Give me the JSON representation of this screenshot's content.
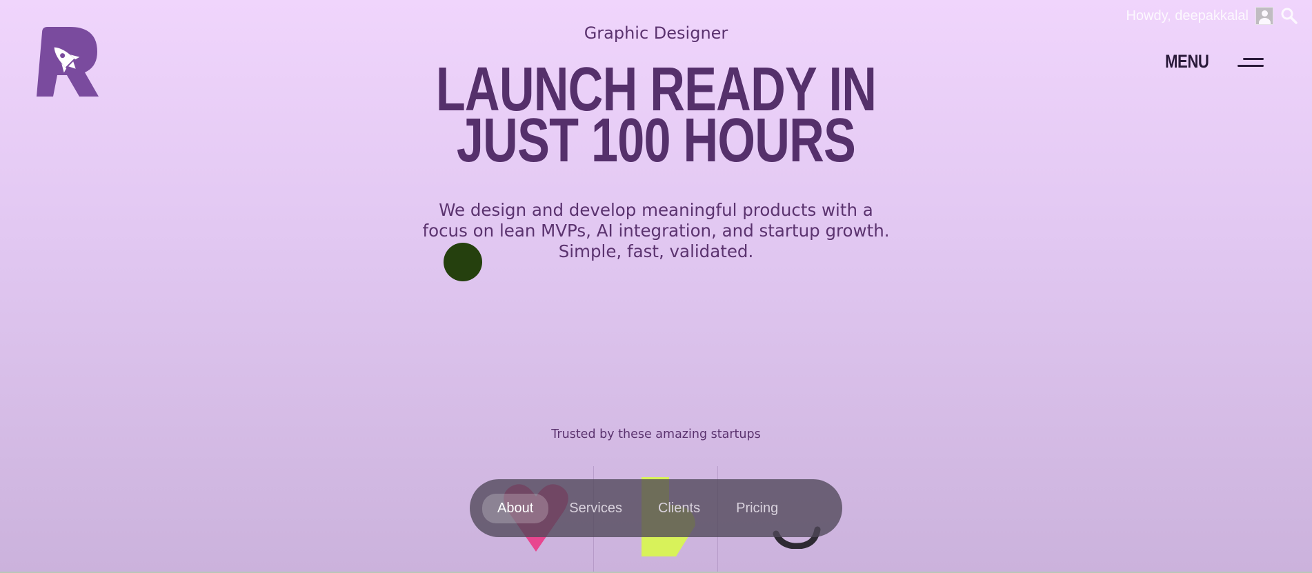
{
  "site": {
    "logo_icon": "rocket-r-logo",
    "brand_color": "#7b4a9e"
  },
  "admin_bar": {
    "greeting": "Howdy, deepakkalal",
    "avatar_icon": "user-avatar-icon",
    "search_icon": "search-icon"
  },
  "header": {
    "menu_label": "MENU",
    "menu_icon": "hamburger-icon"
  },
  "hero": {
    "subtitle": "Graphic Designer",
    "headline_line1": "LAUNCH READY IN",
    "headline_line2": "JUST 100 HOURS",
    "lead": "We design and develop meaningful products with a focus on lean MVPs, AI integration, and startup growth. Simple, fast, validated."
  },
  "trusted": {
    "label": "Trusted by these amazing startups",
    "logos": [
      "pink-heart-logo",
      "lime-shape-logo",
      "dark-letter-logo"
    ]
  },
  "bottom_nav": {
    "items": [
      {
        "label": "About",
        "active": true
      },
      {
        "label": "Services",
        "active": false
      },
      {
        "label": "Clients",
        "active": false
      },
      {
        "label": "Pricing",
        "active": false
      }
    ]
  },
  "colors": {
    "background_top": "#f0d5fc",
    "background_bottom": "#cbb2dc",
    "headline": "#55306b",
    "text": "#5b336f",
    "cursor_dot": "#25400e",
    "nav_pill": "#504858"
  }
}
